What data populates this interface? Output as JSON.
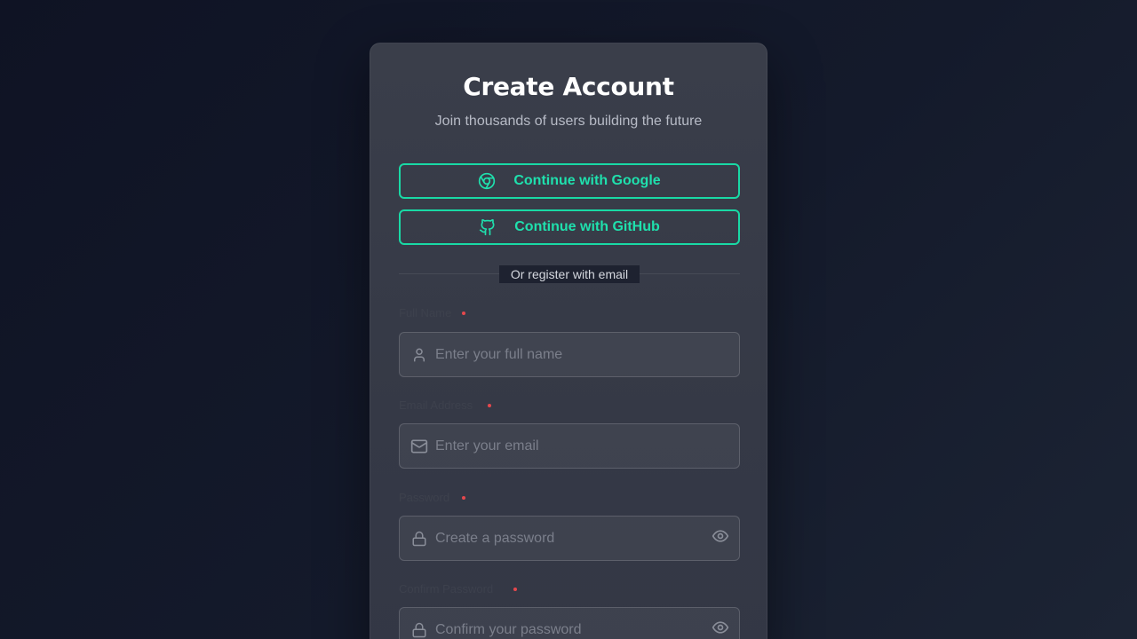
{
  "card": {
    "title": "Create Account",
    "subtitle": "Join thousands of users building the future"
  },
  "social": {
    "google_label": "Continue with Google",
    "github_label": "Continue with GitHub",
    "google_icon": "chrome-icon",
    "github_icon": "github-icon"
  },
  "divider": {
    "text": "Or register with email"
  },
  "fields": [
    {
      "label": "Full Name",
      "required": true,
      "placeholder": "Enter your full name",
      "icon": "user-icon"
    },
    {
      "label": "Email Address",
      "required": true,
      "placeholder": "Enter your email",
      "icon": "mail-icon"
    },
    {
      "label": "Password",
      "required": true,
      "placeholder": "Create a password",
      "icon": "lock-icon",
      "toggle_icon": "eye-icon"
    },
    {
      "label": "Confirm Password",
      "required": true,
      "placeholder": "Confirm your password",
      "icon": "lock-icon",
      "toggle_icon": "eye-icon"
    }
  ],
  "colors": {
    "accent": "#19d9a5",
    "required": "#e5484d",
    "card_bg": "#383c48",
    "page_bg": "#121729"
  }
}
